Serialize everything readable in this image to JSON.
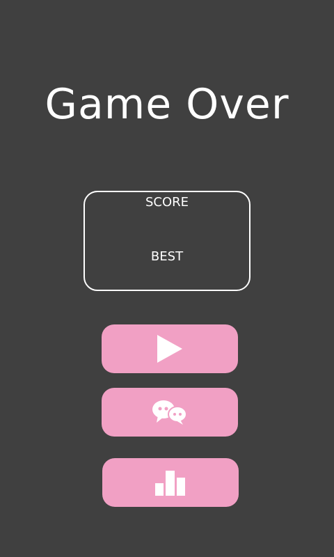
{
  "game_over": {
    "title": "Game Over"
  },
  "score_panel": {
    "score_label": "SCORE",
    "best_label": "BEST"
  },
  "buttons": {
    "play_icon": "play-icon",
    "share_icon": "chat-bubbles-icon",
    "rank_icon": "bar-chart-icon"
  },
  "colors": {
    "background": "#404040",
    "button": "#f1a0c4",
    "text": "#ffffff"
  }
}
